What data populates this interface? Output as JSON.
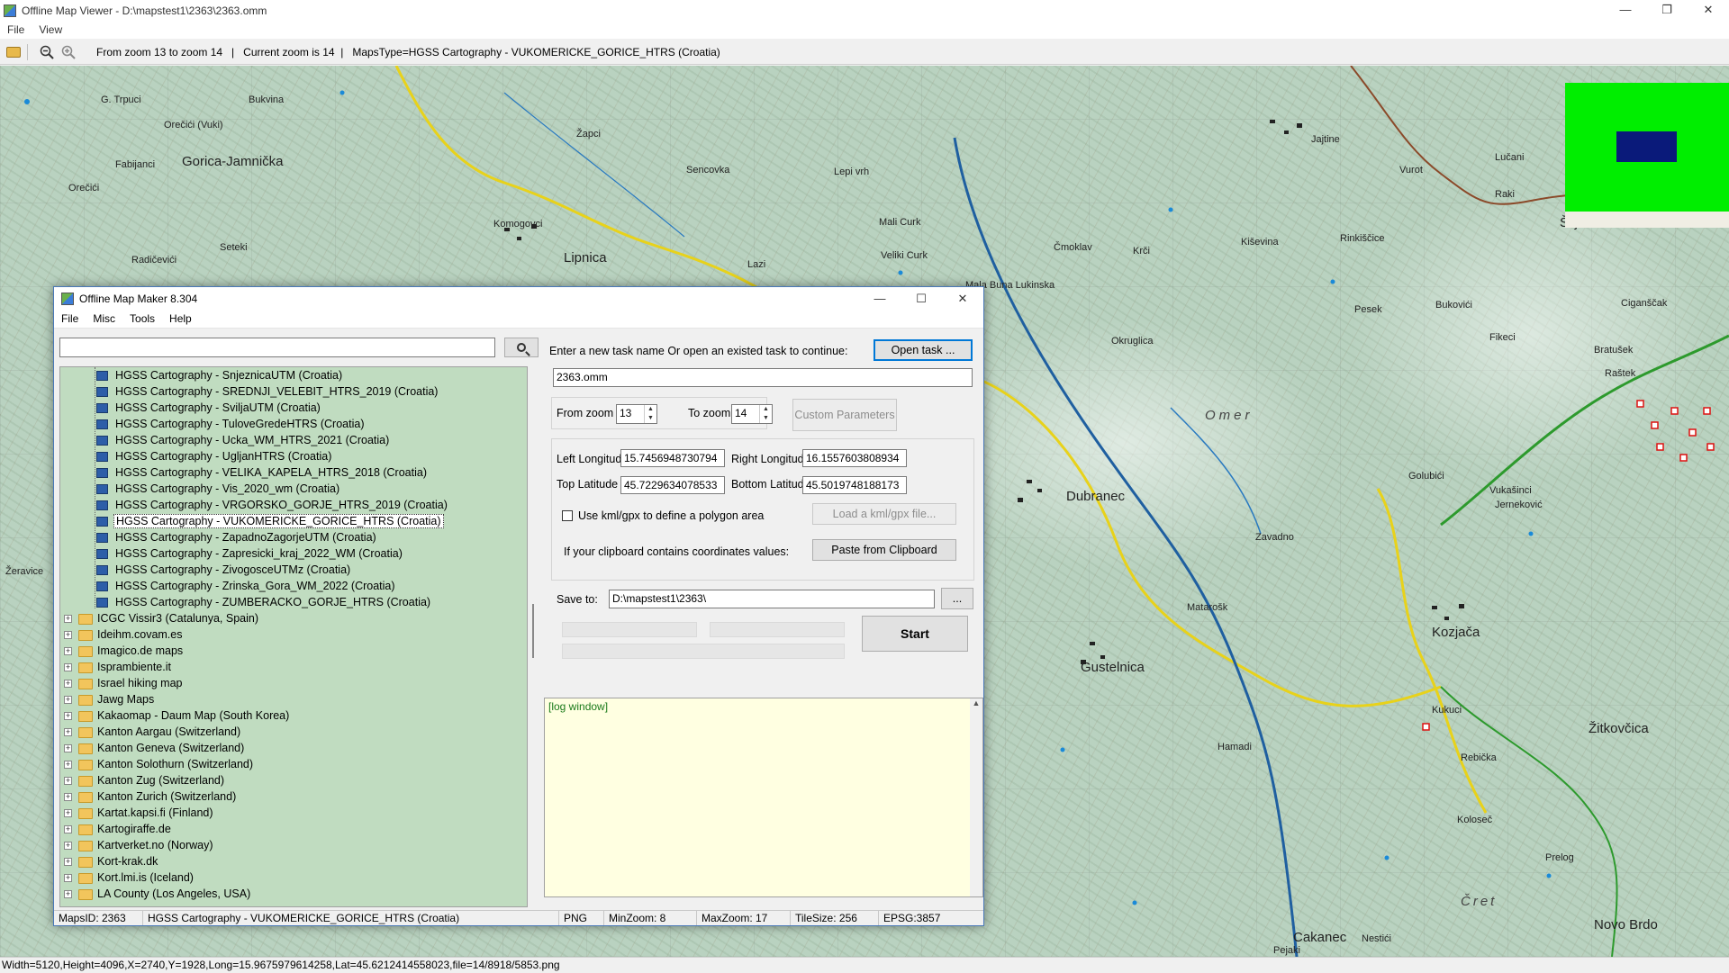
{
  "viewer": {
    "title": "Offline Map Viewer - D:\\mapstest1\\2363\\2363.omm",
    "menu": [
      "File",
      "View"
    ],
    "toolbar_info": "From zoom 13 to zoom 14   |   Current zoom is 14  |   MapsType=HGSS Cartography - VUKOMERICKE_GORICE_HTRS (Croatia)",
    "status": "Width=5120,Height=4096,X=2740,Y=1928,Long=15.9675979614258,Lat=45.6212414558023,file=14/8918/5853.png",
    "window_controls": [
      "—",
      "❐",
      "✕"
    ]
  },
  "map_labels": [
    "G. Trpuci",
    "Bukvina",
    "Orečići (Vuki)",
    "Fabijanci",
    "Gorica-Jamnička",
    "Orečići",
    "Radičevići",
    "Seteki",
    "Komogovci",
    "Lipnica",
    "Žapci",
    "Sencovka",
    "Lepi vrh",
    "Mali Curk",
    "Veliki Curk",
    "Lazi",
    "Jajtine",
    "Vurot",
    "Lučani",
    "Raki",
    "Šiljakovina",
    "Kiševina",
    "Rinkiščice",
    "Mala Buna Lukinska",
    "Čmoklav",
    "Krči",
    "Okruglica",
    "Omer",
    "Pesek",
    "Bukovići",
    "Fikeci",
    "Ciganščak",
    "Bratušek",
    "Raštek",
    "Golubići",
    "Vukašinci",
    "Jerneković",
    "Dubranec",
    "Zavadno",
    "Matarošk",
    "Gustelnica",
    "Kozjača",
    "Hamadi",
    "Rebička",
    "Koloseč",
    "Prelog",
    "Žitkovčica",
    "Čret",
    "Novo Brdo",
    "Cakanec",
    "Pejaki",
    "Nestići",
    "Kukuci",
    "Žeravice"
  ],
  "dialog": {
    "title": "Offline Map Maker 8.304",
    "menu": [
      "File",
      "Misc",
      "Tools",
      "Help"
    ],
    "search_value": "",
    "tree_children": [
      "HGSS Cartography - SnjeznicaUTM (Croatia)",
      "HGSS Cartography - SREDNJI_VELEBIT_HTRS_2019 (Croatia)",
      "HGSS Cartography - SviljaUTM (Croatia)",
      "HGSS Cartography - TuloveGredeHTRS (Croatia)",
      "HGSS Cartography - Ucka_WM_HTRS_2021 (Croatia)",
      "HGSS Cartography - UgljanHTRS (Croatia)",
      "HGSS Cartography - VELIKA_KAPELA_HTRS_2018 (Croatia)",
      "HGSS Cartography - Vis_2020_wm (Croatia)",
      "HGSS Cartography - VRGORSKO_GORJE_HTRS_2019 (Croatia)",
      "HGSS Cartography - VUKOMERICKE_GORICE_HTRS (Croatia)",
      "HGSS Cartography - ZapadnoZagorjeUTM (Croatia)",
      "HGSS Cartography - Zapresicki_kraj_2022_WM (Croatia)",
      "HGSS Cartography - ZivogosceUTMz (Croatia)",
      "HGSS Cartography - Zrinska_Gora_WM_2022 (Croatia)",
      "HGSS Cartography - ZUMBERACKO_GORJE_HTRS (Croatia)"
    ],
    "selected_child": "HGSS Cartography - VUKOMERICKE_GORICE_HTRS (Croatia)",
    "tree_groups": [
      "ICGC Vissir3 (Catalunya, Spain)",
      "Ideihm.covam.es",
      "Imagico.de maps",
      "Isprambiente.it",
      "Israel hiking map",
      "Jawg Maps",
      "Kakaomap - Daum Map (South Korea)",
      "Kanton Aargau (Switzerland)",
      "Kanton Geneva (Switzerland)",
      "Kanton Solothurn (Switzerland)",
      "Kanton Zug (Switzerland)",
      "Kanton Zurich (Switzerland)",
      "Kartat.kapsi.fi (Finland)",
      "Kartogiraffe.de",
      "Kartverket.no (Norway)",
      "Kort-krak.dk",
      "Kort.lmi.is (Iceland)",
      "LA County (Los Angeles, USA)"
    ],
    "task_prompt": "Enter a new task name Or open an existed task to continue:",
    "open_task_label": "Open task ...",
    "task_name": "2363.omm",
    "from_zoom_label": "From zoom",
    "from_zoom_value": "13",
    "to_zoom_label": "To zoom",
    "to_zoom_value": "14",
    "custom_params_label": "Custom Parameters",
    "left_long_label": "Left Longitude",
    "left_long_value": "15.7456948730794",
    "right_long_label": "Right Longitude",
    "right_long_value": "16.1557603808934",
    "top_lat_label": "Top Latitude",
    "top_lat_value": "45.7229634078533",
    "bottom_lat_label": "Bottom Latitude",
    "bottom_lat_value": "45.5019748188173",
    "kml_label": "Use kml/gpx to define a polygon area",
    "load_kml_label": "Load a kml/gpx file...",
    "clipboard_prompt": "If your clipboard contains coordinates values:",
    "paste_label": "Paste from Clipboard",
    "save_to_label": "Save to:",
    "save_to_value": "D:\\mapstest1\\2363\\",
    "browse_label": "...",
    "start_label": "Start",
    "log_text": "[log window]",
    "status": {
      "maps_id": "MapsID: 2363",
      "maps_name": "HGSS Cartography - VUKOMERICKE_GORICE_HTRS (Croatia)",
      "format": "PNG",
      "min_zoom": "MinZoom: 8",
      "max_zoom": "MaxZoom: 17",
      "tile_size": "TileSize: 256",
      "epsg": "EPSG:3857"
    }
  }
}
